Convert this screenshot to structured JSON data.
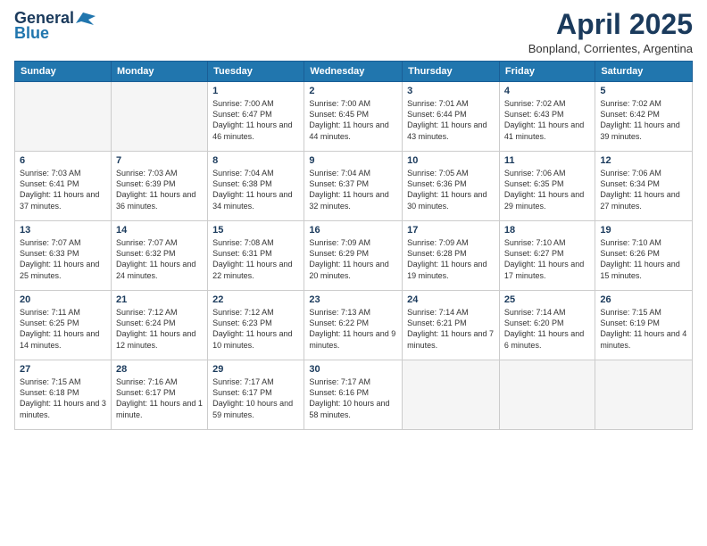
{
  "header": {
    "logo_general": "General",
    "logo_blue": "Blue",
    "month": "April 2025",
    "location": "Bonpland, Corrientes, Argentina"
  },
  "weekdays": [
    "Sunday",
    "Monday",
    "Tuesday",
    "Wednesday",
    "Thursday",
    "Friday",
    "Saturday"
  ],
  "weeks": [
    [
      {
        "day": "",
        "detail": ""
      },
      {
        "day": "",
        "detail": ""
      },
      {
        "day": "1",
        "detail": "Sunrise: 7:00 AM\nSunset: 6:47 PM\nDaylight: 11 hours and 46 minutes."
      },
      {
        "day": "2",
        "detail": "Sunrise: 7:00 AM\nSunset: 6:45 PM\nDaylight: 11 hours and 44 minutes."
      },
      {
        "day": "3",
        "detail": "Sunrise: 7:01 AM\nSunset: 6:44 PM\nDaylight: 11 hours and 43 minutes."
      },
      {
        "day": "4",
        "detail": "Sunrise: 7:02 AM\nSunset: 6:43 PM\nDaylight: 11 hours and 41 minutes."
      },
      {
        "day": "5",
        "detail": "Sunrise: 7:02 AM\nSunset: 6:42 PM\nDaylight: 11 hours and 39 minutes."
      }
    ],
    [
      {
        "day": "6",
        "detail": "Sunrise: 7:03 AM\nSunset: 6:41 PM\nDaylight: 11 hours and 37 minutes."
      },
      {
        "day": "7",
        "detail": "Sunrise: 7:03 AM\nSunset: 6:39 PM\nDaylight: 11 hours and 36 minutes."
      },
      {
        "day": "8",
        "detail": "Sunrise: 7:04 AM\nSunset: 6:38 PM\nDaylight: 11 hours and 34 minutes."
      },
      {
        "day": "9",
        "detail": "Sunrise: 7:04 AM\nSunset: 6:37 PM\nDaylight: 11 hours and 32 minutes."
      },
      {
        "day": "10",
        "detail": "Sunrise: 7:05 AM\nSunset: 6:36 PM\nDaylight: 11 hours and 30 minutes."
      },
      {
        "day": "11",
        "detail": "Sunrise: 7:06 AM\nSunset: 6:35 PM\nDaylight: 11 hours and 29 minutes."
      },
      {
        "day": "12",
        "detail": "Sunrise: 7:06 AM\nSunset: 6:34 PM\nDaylight: 11 hours and 27 minutes."
      }
    ],
    [
      {
        "day": "13",
        "detail": "Sunrise: 7:07 AM\nSunset: 6:33 PM\nDaylight: 11 hours and 25 minutes."
      },
      {
        "day": "14",
        "detail": "Sunrise: 7:07 AM\nSunset: 6:32 PM\nDaylight: 11 hours and 24 minutes."
      },
      {
        "day": "15",
        "detail": "Sunrise: 7:08 AM\nSunset: 6:31 PM\nDaylight: 11 hours and 22 minutes."
      },
      {
        "day": "16",
        "detail": "Sunrise: 7:09 AM\nSunset: 6:29 PM\nDaylight: 11 hours and 20 minutes."
      },
      {
        "day": "17",
        "detail": "Sunrise: 7:09 AM\nSunset: 6:28 PM\nDaylight: 11 hours and 19 minutes."
      },
      {
        "day": "18",
        "detail": "Sunrise: 7:10 AM\nSunset: 6:27 PM\nDaylight: 11 hours and 17 minutes."
      },
      {
        "day": "19",
        "detail": "Sunrise: 7:10 AM\nSunset: 6:26 PM\nDaylight: 11 hours and 15 minutes."
      }
    ],
    [
      {
        "day": "20",
        "detail": "Sunrise: 7:11 AM\nSunset: 6:25 PM\nDaylight: 11 hours and 14 minutes."
      },
      {
        "day": "21",
        "detail": "Sunrise: 7:12 AM\nSunset: 6:24 PM\nDaylight: 11 hours and 12 minutes."
      },
      {
        "day": "22",
        "detail": "Sunrise: 7:12 AM\nSunset: 6:23 PM\nDaylight: 11 hours and 10 minutes."
      },
      {
        "day": "23",
        "detail": "Sunrise: 7:13 AM\nSunset: 6:22 PM\nDaylight: 11 hours and 9 minutes."
      },
      {
        "day": "24",
        "detail": "Sunrise: 7:14 AM\nSunset: 6:21 PM\nDaylight: 11 hours and 7 minutes."
      },
      {
        "day": "25",
        "detail": "Sunrise: 7:14 AM\nSunset: 6:20 PM\nDaylight: 11 hours and 6 minutes."
      },
      {
        "day": "26",
        "detail": "Sunrise: 7:15 AM\nSunset: 6:19 PM\nDaylight: 11 hours and 4 minutes."
      }
    ],
    [
      {
        "day": "27",
        "detail": "Sunrise: 7:15 AM\nSunset: 6:18 PM\nDaylight: 11 hours and 3 minutes."
      },
      {
        "day": "28",
        "detail": "Sunrise: 7:16 AM\nSunset: 6:17 PM\nDaylight: 11 hours and 1 minute."
      },
      {
        "day": "29",
        "detail": "Sunrise: 7:17 AM\nSunset: 6:17 PM\nDaylight: 10 hours and 59 minutes."
      },
      {
        "day": "30",
        "detail": "Sunrise: 7:17 AM\nSunset: 6:16 PM\nDaylight: 10 hours and 58 minutes."
      },
      {
        "day": "",
        "detail": ""
      },
      {
        "day": "",
        "detail": ""
      },
      {
        "day": "",
        "detail": ""
      }
    ]
  ]
}
